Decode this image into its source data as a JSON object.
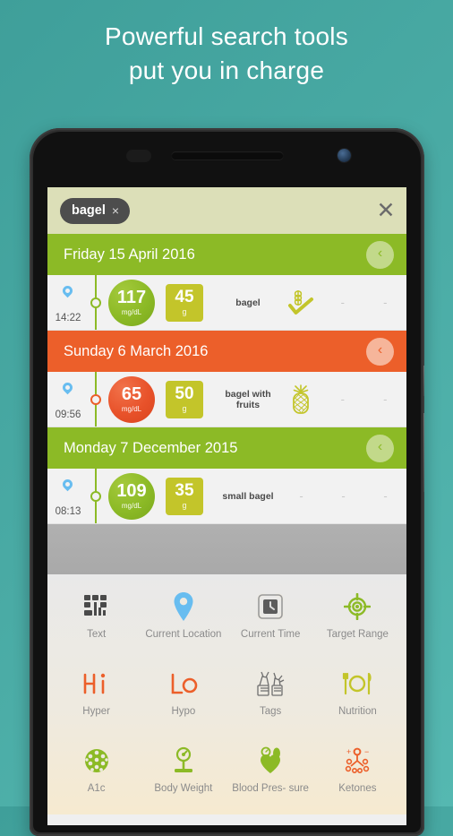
{
  "promo": {
    "line1": "Powerful search tools",
    "line2": "put you in charge"
  },
  "colors": {
    "background_teal": "#49aaa4",
    "green": "#8cba26",
    "orange": "#ec5f2a",
    "olive": "#c3c52a",
    "searchbar": "#dcdfb8",
    "chip": "#4d4d4d",
    "pin_blue": "#68bdf0"
  },
  "search": {
    "chip_label": "bagel",
    "chip_remove": "×",
    "close_label": "✕"
  },
  "sections": [
    {
      "date": "Friday 15 April 2016",
      "color": "green",
      "collapse_icon": "‹",
      "entries": [
        {
          "time": "14:22",
          "glucose": "117",
          "glucose_unit": "mg/dL",
          "glucose_color": "green",
          "carbs": "45",
          "carbs_unit": "g",
          "note": "bagel",
          "food_icon": "wheat-check-icon",
          "dashes": [
            "-",
            "-"
          ]
        }
      ]
    },
    {
      "date": "Sunday 6 March 2016",
      "color": "orange",
      "collapse_icon": "‹",
      "entries": [
        {
          "time": "09:56",
          "glucose": "65",
          "glucose_unit": "mg/dL",
          "glucose_color": "orange",
          "carbs": "50",
          "carbs_unit": "g",
          "note": "bagel with fruits",
          "food_icon": "pineapple-icon",
          "dashes": [
            "-",
            "-"
          ]
        }
      ]
    },
    {
      "date": "Monday 7 December 2015",
      "color": "green",
      "collapse_icon": "‹",
      "entries": [
        {
          "time": "08:13",
          "glucose": "109",
          "glucose_unit": "mg/dL",
          "glucose_color": "green",
          "carbs": "35",
          "carbs_unit": "g",
          "note": "small bagel",
          "food_icon": "none",
          "dashes": [
            "-",
            "-",
            "-"
          ]
        }
      ]
    }
  ],
  "filter_panel": {
    "rows": [
      [
        {
          "label": "Text",
          "icon": "text-blocks-icon"
        },
        {
          "label": "Current Location",
          "icon": "location-pin-icon"
        },
        {
          "label": "Current Time",
          "icon": "clock-bracket-icon"
        },
        {
          "label": "Target Range",
          "icon": "target-icon"
        }
      ],
      [
        {
          "label": "Hyper",
          "icon": "hi-icon"
        },
        {
          "label": "Hypo",
          "icon": "lo-icon"
        },
        {
          "label": "Tags",
          "icon": "tags-icon"
        },
        {
          "label": "Nutrition",
          "icon": "plate-cutlery-icon"
        }
      ],
      [
        {
          "label": "A1c",
          "icon": "molecule-icon"
        },
        {
          "label": "Body Weight",
          "icon": "scale-icon"
        },
        {
          "label": "Blood Pres-\nsure",
          "icon": "heart-gauge-icon"
        },
        {
          "label": "Ketones",
          "icon": "ketone-molecule-icon"
        }
      ]
    ]
  }
}
